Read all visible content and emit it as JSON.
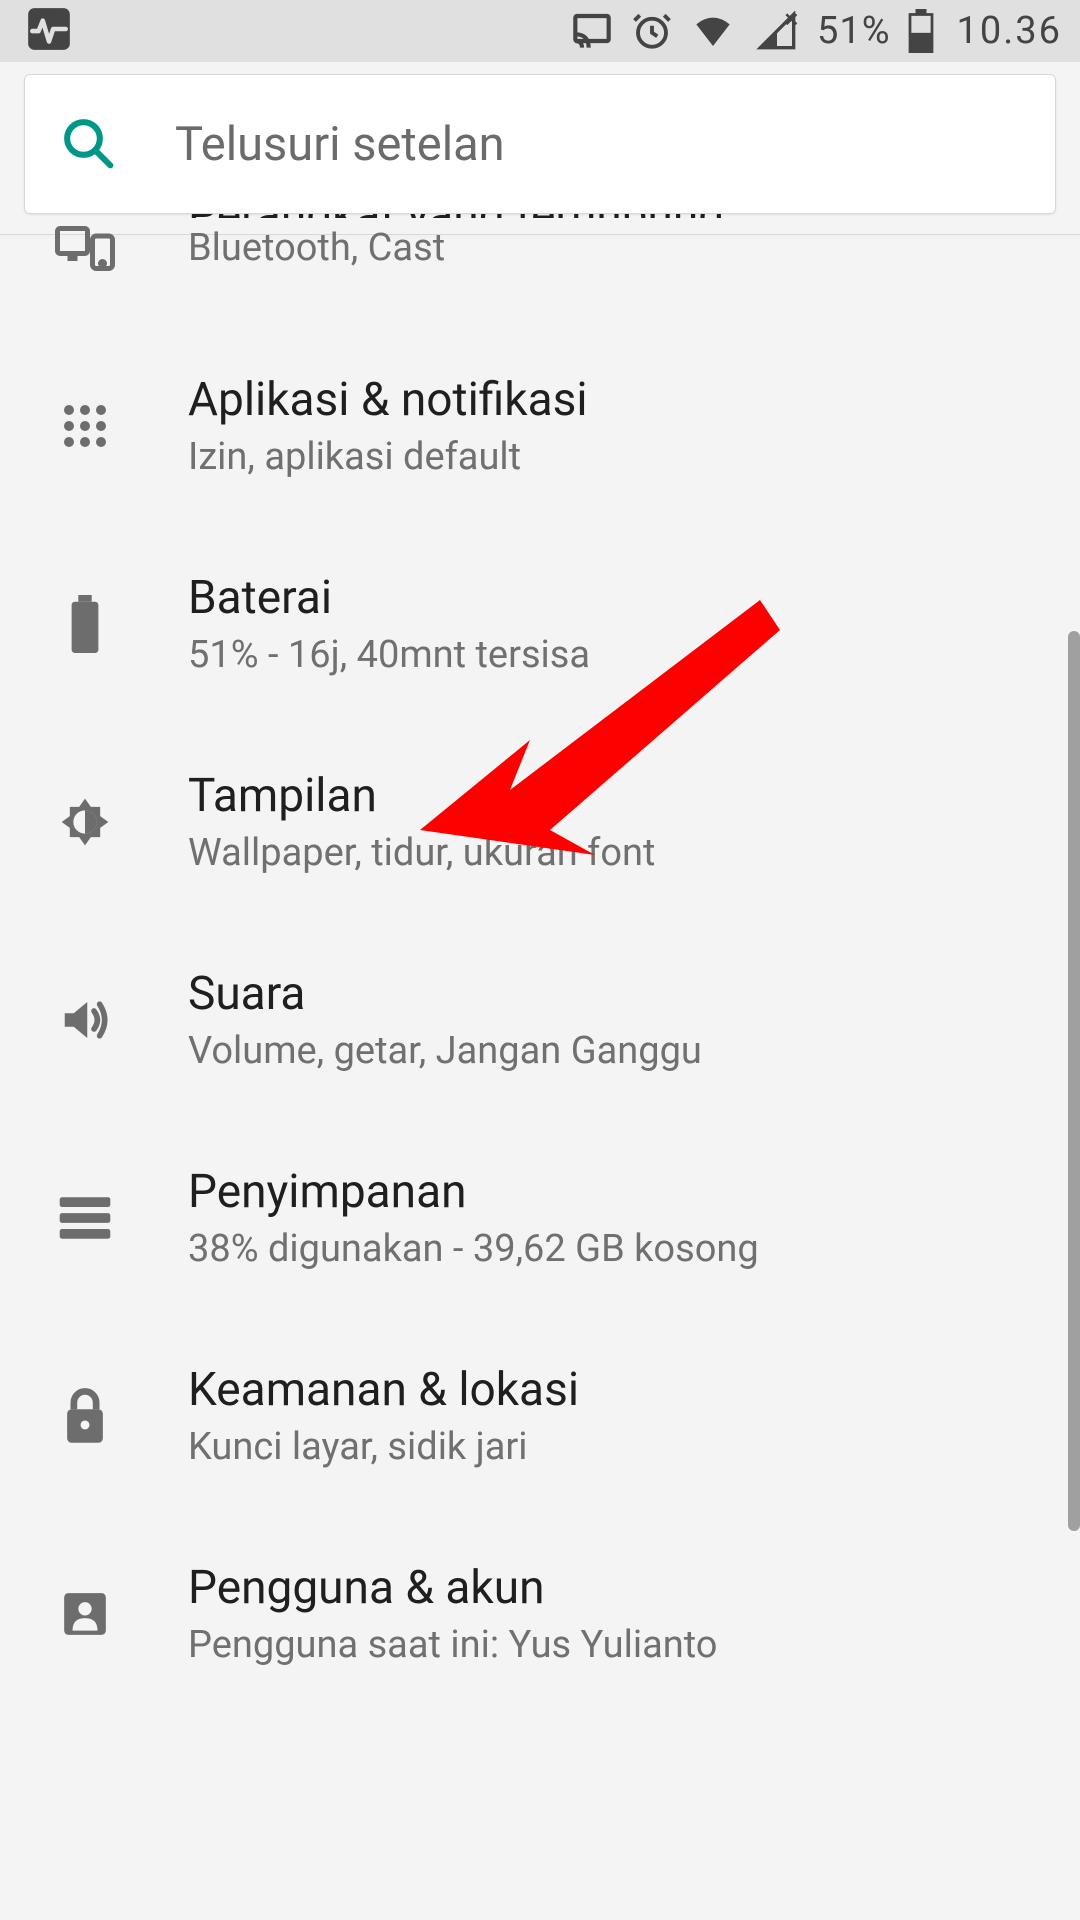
{
  "status_bar": {
    "battery_percent": "51%",
    "time": "10.36"
  },
  "search": {
    "placeholder": "Telusuri setelan"
  },
  "settings": [
    {
      "icon": "devices",
      "title": "Perangkat yang terhubung",
      "sub": "Bluetooth, Cast"
    },
    {
      "icon": "apps",
      "title": "Aplikasi & notifikasi",
      "sub": "Izin, aplikasi default"
    },
    {
      "icon": "battery",
      "title": "Baterai",
      "sub": "51% - 16j, 40mnt tersisa"
    },
    {
      "icon": "display",
      "title": "Tampilan",
      "sub": "Wallpaper, tidur, ukuran font"
    },
    {
      "icon": "sound",
      "title": "Suara",
      "sub": "Volume, getar, Jangan Ganggu"
    },
    {
      "icon": "storage",
      "title": "Penyimpanan",
      "sub": "38% digunakan - 39,62 GB kosong"
    },
    {
      "icon": "lock",
      "title": "Keamanan & lokasi",
      "sub": "Kunci layar, sidik jari"
    },
    {
      "icon": "user",
      "title": "Pengguna & akun",
      "sub": "Pengguna saat ini: Yus Yulianto"
    }
  ],
  "annotation": {
    "arrow_target": "Tampilan"
  }
}
